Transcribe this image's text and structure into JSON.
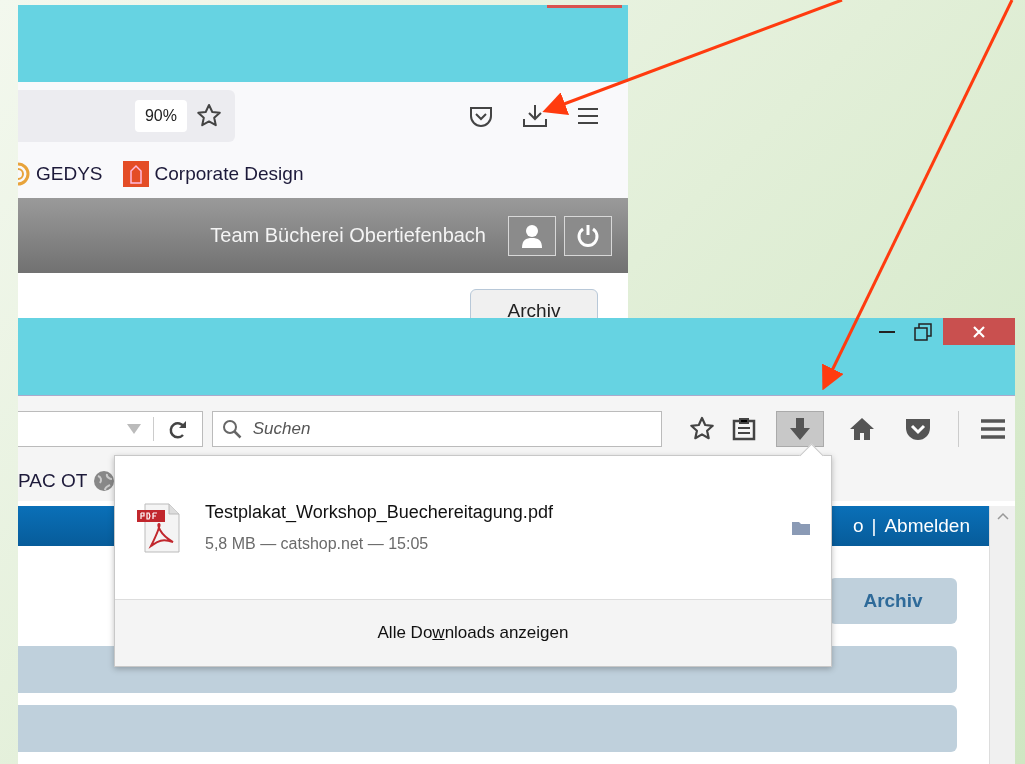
{
  "top_window": {
    "toolbar": {
      "zoom": "90%"
    },
    "bookmarks": [
      {
        "label": "GEDYS",
        "kind": "rings"
      },
      {
        "label": "Corporate Design",
        "kind": "tile"
      }
    ],
    "header": {
      "user": "Team Bücherei Obertiefenbach"
    },
    "content": {
      "button": "Archiv"
    }
  },
  "bottom_window": {
    "search": {
      "placeholder": "Suchen"
    },
    "toolbar": {
      "downloads_active": true
    },
    "bookmarks": [
      {
        "label": "PAC OT"
      }
    ],
    "header": {
      "cut_link": "o",
      "separator": "|",
      "logout": "Abmelden"
    },
    "content": {
      "button": "Archiv"
    }
  },
  "downloads_popup": {
    "items": [
      {
        "file": "Testplakat_Workshop_Buechereitagung.pdf",
        "details": "5,8 MB — catshop.net — 15:05"
      }
    ],
    "footer": {
      "before": "Alle Do",
      "access_key": "w",
      "after": "nloads anzeigen"
    }
  }
}
